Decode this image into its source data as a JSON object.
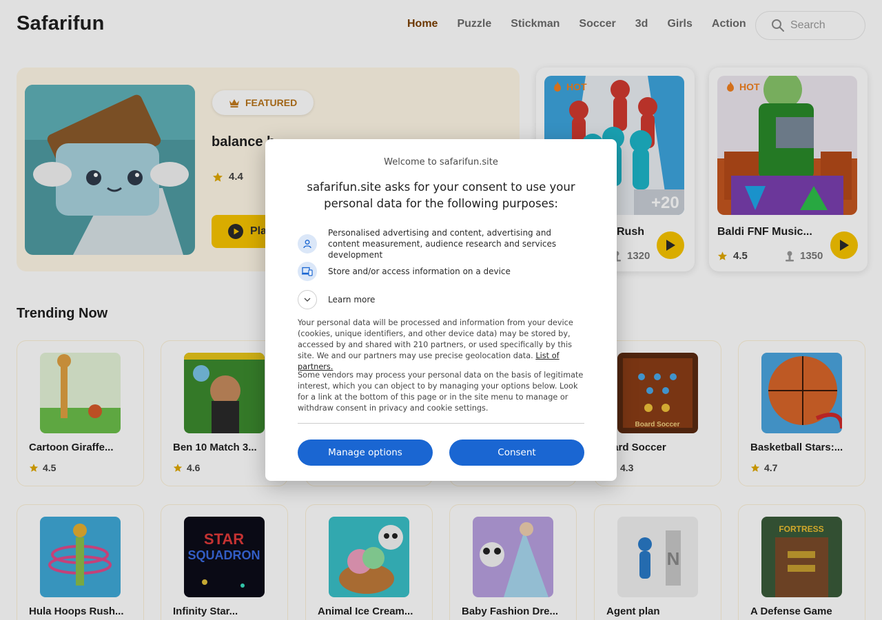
{
  "header": {
    "logo": "Safarifun",
    "nav": [
      "Home",
      "Puzzle",
      "Stickman",
      "Soccer",
      "3d",
      "Girls",
      "Action"
    ],
    "search_placeholder": "Search"
  },
  "featured": {
    "badge": "FEATURED",
    "title": "balance b...",
    "rating": "4.4",
    "play_label": "Play"
  },
  "hot_cards": [
    {
      "tag": "HOT",
      "name": "Rush",
      "rating": "",
      "plays": "1320"
    },
    {
      "tag": "HOT",
      "name": "Baldi FNF Music...",
      "rating": "4.5",
      "plays": "1350"
    }
  ],
  "trending": {
    "title": "Trending Now",
    "row1": [
      {
        "name": "Cartoon Giraffe...",
        "rating": "4.5"
      },
      {
        "name": "Ben 10 Match 3...",
        "rating": "4.6"
      },
      {
        "name": "",
        "rating": ""
      },
      {
        "name": "",
        "rating": ""
      },
      {
        "name": "oard Soccer",
        "rating": "4.3"
      },
      {
        "name": "Basketball Stars:...",
        "rating": "4.7"
      }
    ],
    "row2": [
      {
        "name": "Hula Hoops Rush..."
      },
      {
        "name": "Infinity Star..."
      },
      {
        "name": "Animal Ice Cream..."
      },
      {
        "name": "Baby Fashion Dre..."
      },
      {
        "name": "Agent plan"
      },
      {
        "name": "A Defense Game"
      }
    ]
  },
  "consent": {
    "welcome": "Welcome to safarifun.site",
    "heading": "safarifun.site asks for your consent to use your personal data for the following purposes:",
    "purpose1": "Personalised advertising and content, advertising and content measurement, audience research and services development",
    "purpose2": "Store and/or access information on a device",
    "learn_more": "Learn more",
    "para1": "Your personal data will be processed and information from your device (cookies, unique identifiers, and other device data) may be stored by, accessed by and shared with 210 partners, or used specifically by this site. We and our partners may use precise geolocation data.",
    "partners_link": "List of partners.",
    "para2": "Some vendors may process your personal data on the basis of legitimate interest, which you can object to by managing your options below. Look for a link at the bottom of this page or in the site menu to manage or withdraw consent in privacy and cookie settings.",
    "manage_label": "Manage options",
    "consent_label": "Consent"
  },
  "colors": {
    "accent": "#f8c400",
    "button_blue": "#1a66d2",
    "hot": "#d3701b"
  }
}
